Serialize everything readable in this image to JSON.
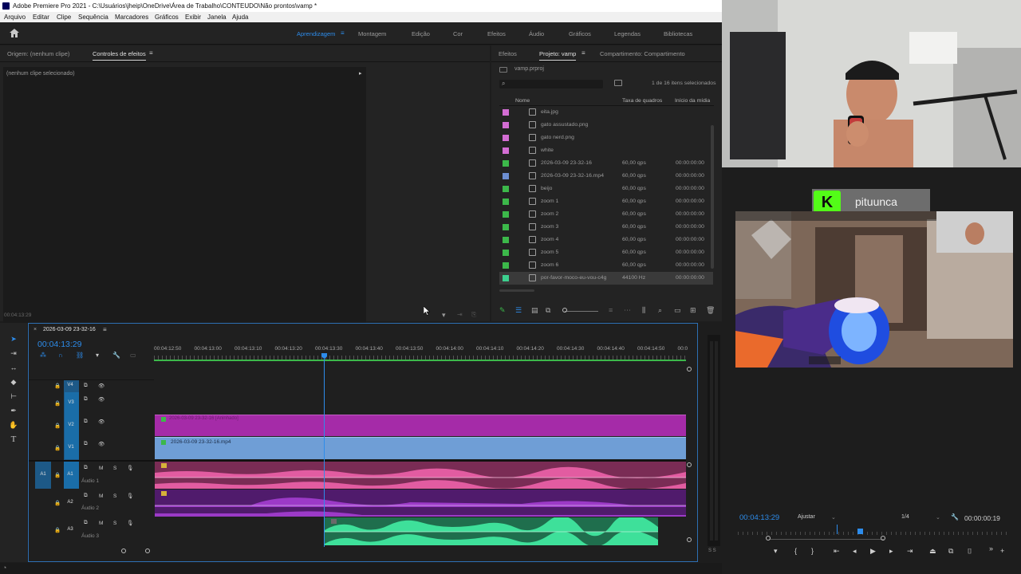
{
  "window": {
    "title": "Adobe Premiere Pro 2021 - C:\\Usuários\\jheip\\OneDrive\\Área de Trabalho\\CONTEUDO\\Não prontos\\vamp *"
  },
  "menu": [
    "Arquivo",
    "Editar",
    "Clipe",
    "Sequência",
    "Marcadores",
    "Gráficos",
    "Exibir",
    "Janela",
    "Ajuda"
  ],
  "workspaces": [
    "Aprendizagem",
    "Montagem",
    "Edição",
    "Cor",
    "Efeitos",
    "Áudio",
    "Gráficos",
    "Legendas",
    "Bibliotecas"
  ],
  "source_panel": {
    "tab_origin": "Origem: (nenhum clipe)",
    "tab_effects": "Controles de efeitos",
    "no_clip": "(nenhum clipe selecionado)",
    "timecode": "00:04:13:29"
  },
  "project_panel": {
    "tabs": [
      "Efeitos",
      "Projeto: vamp",
      "Compartimento: Compartimento"
    ],
    "file": "vamp.prproj",
    "selection_info": "1 de 16 itens selecionados",
    "columns": [
      "Nome",
      "Taxa de quadros",
      "Início da mídia"
    ],
    "rows": [
      {
        "name": "eita.jpg",
        "fps": "",
        "start": "",
        "color": "#d36dd3"
      },
      {
        "name": "gato assustado.png",
        "fps": "",
        "start": "",
        "color": "#d36dd3"
      },
      {
        "name": "gato nerd.png",
        "fps": "",
        "start": "",
        "color": "#d36dd3"
      },
      {
        "name": "white",
        "fps": "",
        "start": "",
        "color": "#d36dd3"
      },
      {
        "name": "2026-03-09 23-32-16",
        "fps": "60,00 qps",
        "start": "00:00:00:00",
        "color": "#3cb84a"
      },
      {
        "name": "2026-03-09 23-32-16.mp4",
        "fps": "60,00 qps",
        "start": "00:00:00:00",
        "color": "#6d8fd1"
      },
      {
        "name": "beijo",
        "fps": "60,00 qps",
        "start": "00:00:00:00",
        "color": "#3cb84a"
      },
      {
        "name": "zoom 1",
        "fps": "60,00 qps",
        "start": "00:00:00:00",
        "color": "#3cb84a"
      },
      {
        "name": "zoom 2",
        "fps": "60,00 qps",
        "start": "00:00:00:00",
        "color": "#3cb84a"
      },
      {
        "name": "zoom 3",
        "fps": "60,00 qps",
        "start": "00:00:00:00",
        "color": "#3cb84a"
      },
      {
        "name": "zoom 4",
        "fps": "60,00 qps",
        "start": "00:00:00:00",
        "color": "#3cb84a"
      },
      {
        "name": "zoom 5",
        "fps": "60,00 qps",
        "start": "00:00:00:00",
        "color": "#3cb84a"
      },
      {
        "name": "zoom 6",
        "fps": "60,00 qps",
        "start": "00:00:00:00",
        "color": "#3cb84a"
      },
      {
        "name": "por-favor-moco-eu-vou-c4g",
        "fps": "44100 Hz",
        "start": "00:00:00:00",
        "color": "#3ccf8e"
      }
    ]
  },
  "timeline": {
    "sequence_tab": "2026-03-09 23-32-16",
    "timecode": "00:04:13:29",
    "ruler": [
      "00:04:12:50",
      "00:04:13:00",
      "00:04:13:10",
      "00:04:13:20",
      "00:04:13:30",
      "00:04:13:40",
      "00:04:13:50",
      "00:04:14:00",
      "00:04:14:10",
      "00:04:14:20",
      "00:04:14:30",
      "00:04:14:40",
      "00:04:14:50",
      "00:0"
    ],
    "video_tracks": [
      "V4",
      "V3",
      "V2",
      "V1"
    ],
    "audio_tracks": [
      {
        "id": "A1",
        "name": "Áudio 1"
      },
      {
        "id": "A2",
        "name": "Áudio 2"
      },
      {
        "id": "A3",
        "name": "Áudio 3"
      }
    ],
    "src_patch": "A1",
    "track_btn_m": "M",
    "track_btn_s": "S",
    "clip_v1": "2026-03-09 23-32-16.mp4",
    "clip_v2": "2026-03-09 23-32-16 [Aninhado]"
  },
  "overlay": {
    "streamer_name": "pituunca",
    "kick_letter": "K"
  },
  "program": {
    "timecode": "00:04:13:29",
    "fit": "Ajustar",
    "resolution": "1/4",
    "duration": "00:00:00:19"
  },
  "status_bar": {
    "meter_label": "S S"
  }
}
